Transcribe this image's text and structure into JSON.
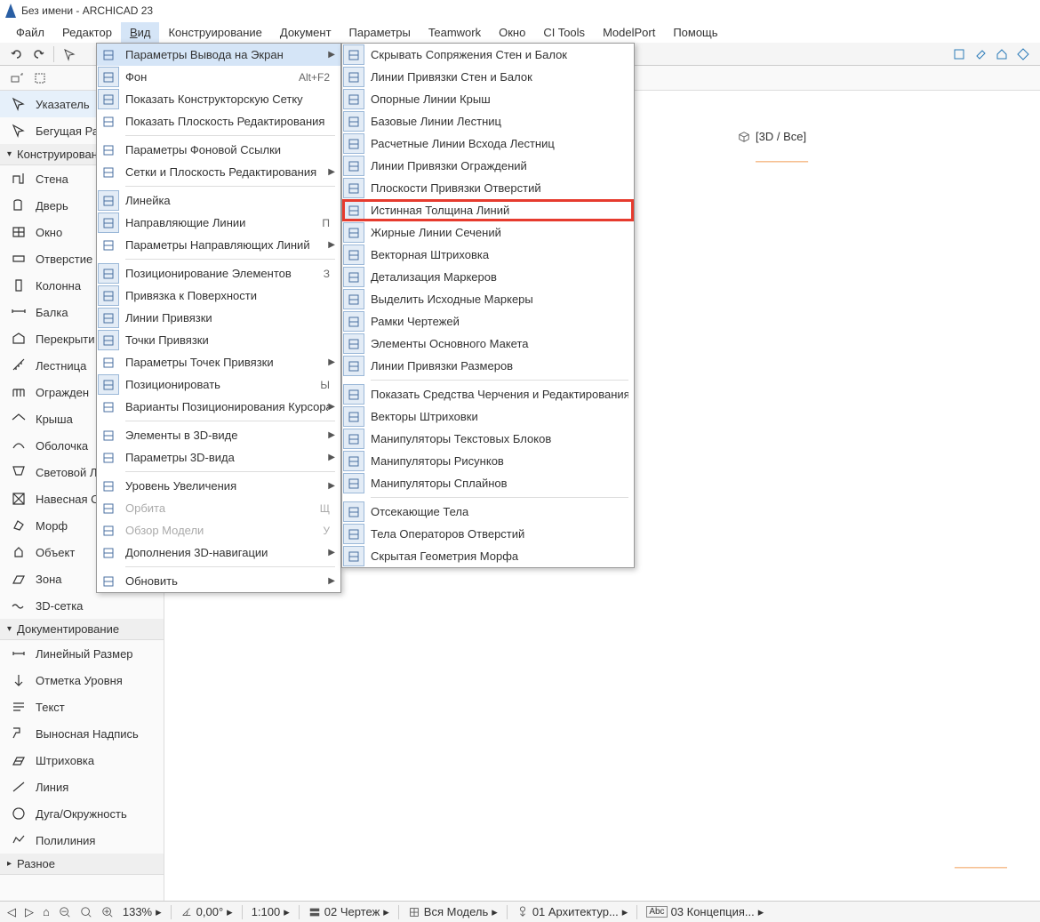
{
  "title": "Без имени - ARCHICAD 23",
  "menubar": [
    "Файл",
    "Редактор",
    "Вид",
    "Конструирование",
    "Документ",
    "Параметры",
    "Teamwork",
    "Окно",
    "CI Tools",
    "ModelPort",
    "Помощь"
  ],
  "menubar_open_index": 2,
  "menu1": [
    {
      "label": "Параметры Вывода на Экран",
      "sub": true,
      "sel": true
    },
    {
      "label": "Фон",
      "hot": "Alt+F2",
      "iconBox": true
    },
    {
      "label": "Показать Конструкторскую Сетку",
      "iconBox": true
    },
    {
      "label": "Показать Плоскость Редактирования"
    },
    {
      "sep": true
    },
    {
      "label": "Параметры Фоновой Ссылки"
    },
    {
      "label": "Сетки и Плоскость Редактирования",
      "sub": true
    },
    {
      "sep": true
    },
    {
      "label": "Линейка",
      "iconBox": true
    },
    {
      "label": "Направляющие Линии",
      "iconBox": true,
      "hot": "П"
    },
    {
      "label": "Параметры Направляющих Линий",
      "sub": true
    },
    {
      "sep": true
    },
    {
      "label": "Позиционирование Элементов",
      "iconBox": true,
      "hot": "З"
    },
    {
      "label": "Привязка к Поверхности",
      "iconBox": true
    },
    {
      "label": "Линии Привязки",
      "iconBox": true
    },
    {
      "label": "Точки Привязки",
      "iconBox": true
    },
    {
      "label": "Параметры Точек Привязки",
      "sub": true
    },
    {
      "label": "Позиционировать",
      "iconBox": true,
      "hot": "Ы"
    },
    {
      "label": "Варианты Позиционирования Курсора",
      "sub": true
    },
    {
      "sep": true
    },
    {
      "label": "Элементы в 3D-виде",
      "sub": true
    },
    {
      "label": "Параметры 3D-вида",
      "sub": true
    },
    {
      "sep": true
    },
    {
      "label": "Уровень Увеличения",
      "sub": true
    },
    {
      "label": "Орбита",
      "iconBox": false,
      "hot": "Щ",
      "disabled": true
    },
    {
      "label": "Обзор Модели",
      "iconBox": false,
      "hot": "У",
      "disabled": true
    },
    {
      "label": "Дополнения 3D-навигации",
      "sub": true
    },
    {
      "sep": true
    },
    {
      "label": "Обновить",
      "sub": true
    }
  ],
  "menu2": [
    {
      "label": "Скрывать Сопряжения Стен и Балок",
      "iconBox": true
    },
    {
      "label": "Линии Привязки Стен и Балок",
      "iconBox": true
    },
    {
      "label": "Опорные Линии Крыш",
      "iconBox": true
    },
    {
      "label": "Базовые Линии Лестниц",
      "iconBox": true
    },
    {
      "label": "Расчетные Линии Всхода Лестниц",
      "iconBox": true
    },
    {
      "label": "Линии Привязки Ограждений",
      "iconBox": true
    },
    {
      "label": "Плоскости Привязки Отверстий",
      "iconBox": true
    },
    {
      "label": "Истинная Толщина Линий",
      "iconBox": true,
      "highlight": true
    },
    {
      "label": "Жирные Линии Сечений",
      "iconBox": true
    },
    {
      "label": "Векторная Штриховка",
      "iconBox": true
    },
    {
      "label": "Детализация Маркеров",
      "iconBox": true
    },
    {
      "label": "Выделить Исходные Маркеры",
      "iconBox": true
    },
    {
      "label": "Рамки Чертежей",
      "iconBox": true
    },
    {
      "label": "Элементы Основного Макета",
      "iconBox": true
    },
    {
      "label": "Линии Привязки Размеров",
      "iconBox": true
    },
    {
      "sep": true
    },
    {
      "label": "Показать Средства Черчения и Редактирования",
      "iconBox": true
    },
    {
      "label": "Векторы Штриховки",
      "iconBox": true
    },
    {
      "label": "Манипуляторы Текстовых Блоков",
      "iconBox": true
    },
    {
      "label": "Манипуляторы Рисунков",
      "iconBox": true
    },
    {
      "label": "Манипуляторы Сплайнов",
      "iconBox": true
    },
    {
      "sep": true
    },
    {
      "label": "Отсекающие Тела",
      "iconBox": true
    },
    {
      "label": "Тела Операторов Отверстий",
      "iconBox": true
    },
    {
      "label": "Скрытая Геометрия Морфа",
      "iconBox": true
    }
  ],
  "tools": {
    "pointer_header": {
      "items": [
        {
          "label": "Указатель",
          "sel": true
        },
        {
          "label": "Бегущая Ра"
        }
      ]
    },
    "construction_header": "Конструировани",
    "construction_items": [
      "Стена",
      "Дверь",
      "Окно",
      "Отверстие",
      "Колонна",
      "Балка",
      "Перекрыти",
      "Лестница",
      "Огражден",
      "Крыша",
      "Оболочка",
      "Световой Л",
      "Навесная С",
      "Морф",
      "Объект",
      "Зона",
      "3D-сетка"
    ],
    "doc_header": "Документирование",
    "doc_items": [
      "Линейный Размер",
      "Отметка Уровня",
      "Текст",
      "Выносная Надпись",
      "Штриховка",
      "Линия",
      "Дуга/Окруж­ность",
      "Полилиния"
    ],
    "misc_header": "Разное"
  },
  "tab3d": "[3D / Все]",
  "status": {
    "zoom": "133%",
    "angle": "0,00°",
    "scale": "1:100",
    "view": "02 Чертеж",
    "model": "Вся Модель",
    "arch": "01 Архитектур...",
    "concept": "03 Концепция...",
    "unit": "Abc"
  }
}
